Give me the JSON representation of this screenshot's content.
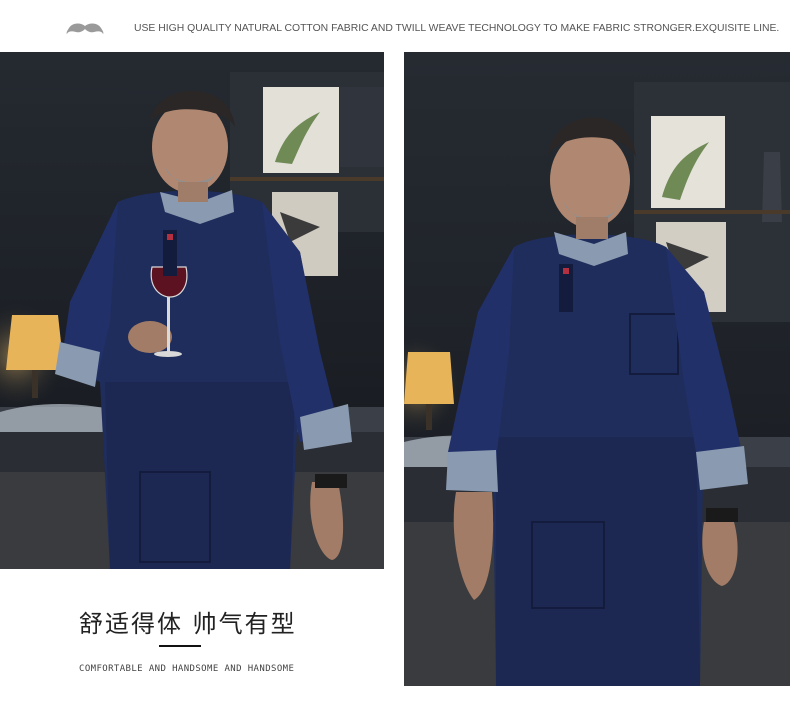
{
  "banner": {
    "mustache_icon": "mustache-icon",
    "tagline": "USE HIGH QUALITY NATURAL COTTON FABRIC AND TWILL WEAVE TECHNOLOGY TO MAKE FABRIC STRONGER.EXQUISITE LINE."
  },
  "caption": {
    "title_zh": "舒适得体 帅气有型",
    "subtitle_en": "COMFORTABLE AND HANDSOME AND HANDSOME"
  },
  "colors": {
    "uniform_navy": "#1f2d5c",
    "cuff_gray": "#8a9ab0",
    "background_dark": "#1b1f26",
    "lamp_glow": "#e6b96a"
  }
}
